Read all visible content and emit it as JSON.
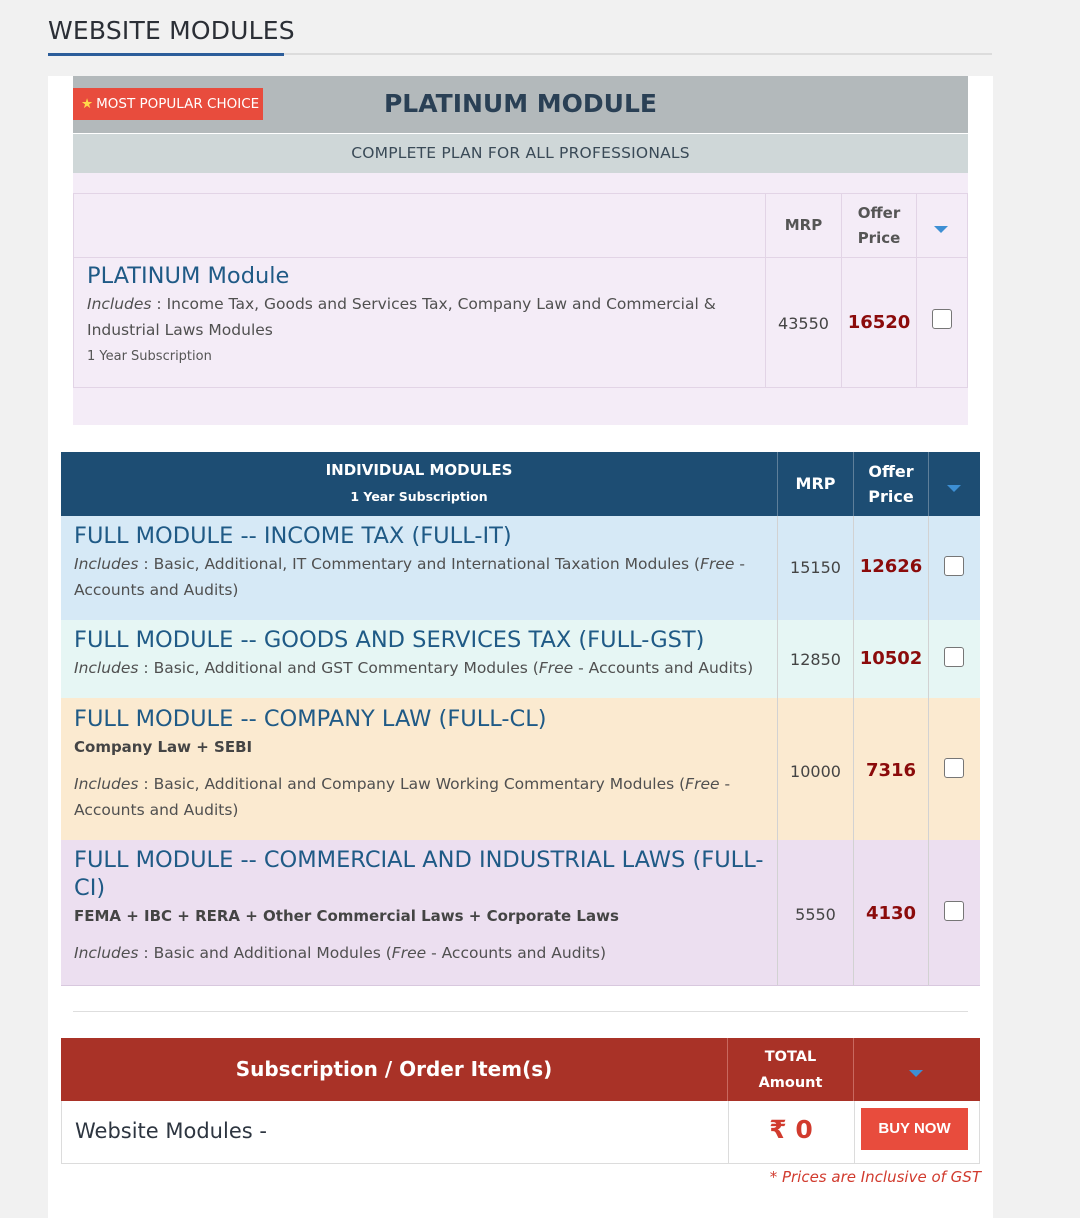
{
  "section": {
    "title": "WEBSITE MODULES"
  },
  "platinum": {
    "badge": "MOST POPULAR CHOICE",
    "title": "PLATINUM MODULE",
    "subtitle": "COMPLETE PLAN FOR ALL PROFESSIONALS",
    "col_mrp": "MRP",
    "col_offer_1": "Offer",
    "col_offer_2": "Price",
    "item": {
      "name": "PLATINUM Module",
      "includes_label": "Includes",
      "includes_text": " : Income Tax, Goods and Services Tax, Company Law and Commercial & Industrial Laws Modules",
      "note": "1 Year Subscription",
      "mrp": "43550",
      "offer": "16520"
    }
  },
  "individual": {
    "header_title": "INDIVIDUAL MODULES",
    "header_sub": "1 Year Subscription",
    "col_mrp": "MRP",
    "col_offer_1": "Offer",
    "col_offer_2": "Price",
    "modules": [
      {
        "name": "FULL MODULE -- INCOME TAX (FULL-IT)",
        "includes_label": "Includes",
        "includes_text": " : Basic, Additional, IT Commentary and International Taxation Modules (",
        "free_label": "Free",
        "free_text": " - Accounts and Audits)",
        "mrp": "15150",
        "offer": "12626",
        "bg": "#d6e9f6"
      },
      {
        "name": "FULL MODULE -- GOODS AND SERVICES TAX (FULL-GST)",
        "includes_label": "Includes",
        "includes_text": " : Basic, Additional and GST Commentary Modules (",
        "free_label": "Free",
        "free_text": " - Accounts and Audits)",
        "mrp": "12850",
        "offer": "10502",
        "bg": "#e6f6f4"
      },
      {
        "name": "FULL MODULE -- COMPANY LAW (FULL-CL)",
        "sub": "Company Law + SEBI",
        "includes_label": "Includes",
        "includes_text": " : Basic, Additional and Company Law Working Commentary Modules (",
        "free_label": "Free",
        "free_text": " - Accounts and Audits)",
        "mrp": "10000",
        "offer": "7316",
        "bg": "#fbead0"
      },
      {
        "name": "FULL MODULE -- COMMERCIAL AND INDUSTRIAL LAWS (FULL-CI)",
        "sub": "FEMA + IBC + RERA + Other Commercial Laws + Corporate Laws",
        "includes_label": "Includes",
        "includes_text": " : Basic and Additional Modules (",
        "free_label": "Free",
        "free_text": " - Accounts and Audits)",
        "mrp": "5550",
        "offer": "4130",
        "bg": "#ecdff0"
      }
    ]
  },
  "order": {
    "title": "Subscription / Order Item(s)",
    "total_1": "TOTAL",
    "total_2": "Amount",
    "item": "Website Modules -",
    "amount": "₹ 0",
    "buy": "BUY NOW",
    "note": "* Prices are Inclusive of GST"
  },
  "colors": {
    "header_blue": "#1d4d73",
    "order_red": "#a93227",
    "accent": "#e84c3d",
    "price_red": "#8b0b0b"
  }
}
